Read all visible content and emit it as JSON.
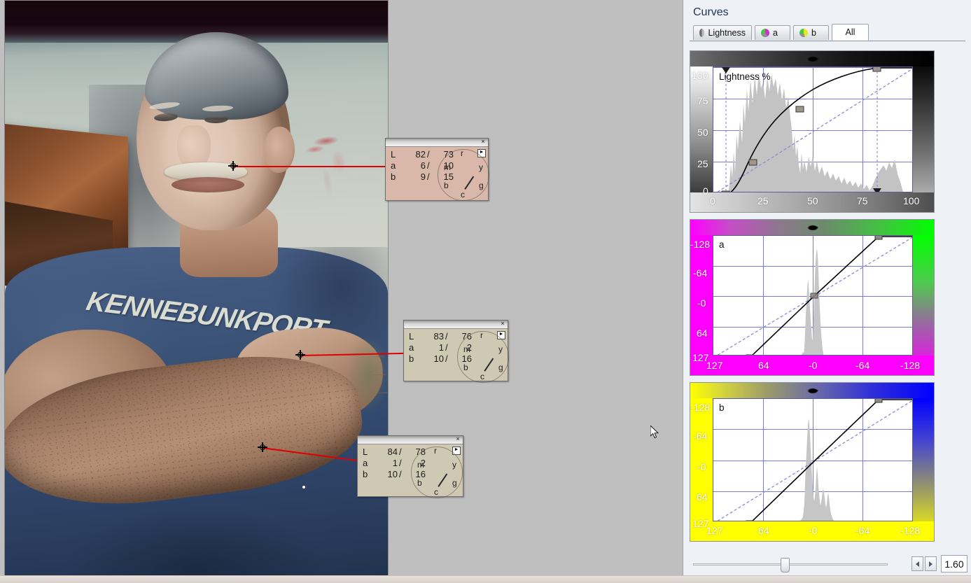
{
  "app": {
    "panel_title": "Curves"
  },
  "tabs": [
    {
      "id": "lightness",
      "label": "Lightness",
      "icon": "lightness-wheel-icon",
      "active": false
    },
    {
      "id": "a",
      "label": "a",
      "icon": "a-channel-wheel-icon",
      "active": false
    },
    {
      "id": "b",
      "label": "b",
      "icon": "b-channel-wheel-icon",
      "active": false
    },
    {
      "id": "all",
      "label": "All",
      "icon": null,
      "active": true
    }
  ],
  "zoom_toolbar": {
    "slider_value_label": "1.60",
    "left_arrow": "◄",
    "right_arrow": "►"
  },
  "samples": [
    {
      "id": "sample-1",
      "title_close": "×",
      "menu_glyph": "►",
      "rows": [
        {
          "label": "L",
          "before": "82",
          "sep": "/",
          "after": "73"
        },
        {
          "label": "a",
          "before": "6",
          "sep": "/",
          "after": "10"
        },
        {
          "label": "b",
          "before": "9",
          "sep": "/",
          "after": "15"
        }
      ],
      "wheel_labels": [
        "r",
        "y",
        "g",
        "c",
        "b",
        "m"
      ]
    },
    {
      "id": "sample-2",
      "title_close": "×",
      "menu_glyph": "►",
      "rows": [
        {
          "label": "L",
          "before": "83",
          "sep": "/",
          "after": "76"
        },
        {
          "label": "a",
          "before": "1",
          "sep": "/",
          "after": "2"
        },
        {
          "label": "b",
          "before": "10",
          "sep": "/",
          "after": "16"
        }
      ],
      "wheel_labels": [
        "r",
        "y",
        "g",
        "c",
        "b",
        "m"
      ]
    },
    {
      "id": "sample-3",
      "title_close": "×",
      "menu_glyph": "►",
      "rows": [
        {
          "label": "L",
          "before": "84",
          "sep": "/",
          "after": "78"
        },
        {
          "label": "a",
          "before": "1",
          "sep": "/",
          "after": "2"
        },
        {
          "label": "b",
          "before": "10",
          "sep": "/",
          "after": "16"
        }
      ],
      "wheel_labels": [
        "r",
        "y",
        "g",
        "c",
        "b",
        "m"
      ]
    }
  ],
  "photo": {
    "shirt_text": "KENNEBUNKPORT"
  },
  "chart_data": [
    {
      "id": "lightness-curve",
      "type": "line",
      "title": "Lightness %",
      "xlabel": "",
      "ylabel": "",
      "xlim": [
        0,
        100
      ],
      "ylim": [
        0,
        100
      ],
      "xticks": [
        0,
        25,
        50,
        75,
        100
      ],
      "yticks": [
        0,
        25,
        50,
        75,
        100
      ],
      "grid": true,
      "gradient": "black-to-white",
      "series": [
        {
          "name": "curve",
          "style": "solid",
          "points": [
            [
              0,
              0
            ],
            [
              6,
              0
            ],
            [
              10,
              4
            ],
            [
              15,
              20
            ],
            [
              20,
              33
            ],
            [
              25,
              44
            ],
            [
              30,
              53
            ],
            [
              35,
              60
            ],
            [
              43,
              67
            ],
            [
              50,
              75
            ],
            [
              60,
              84
            ],
            [
              70,
              92
            ],
            [
              81,
              99
            ],
            [
              82,
              100
            ],
            [
              100,
              100
            ]
          ]
        },
        {
          "name": "identity",
          "style": "dashed",
          "points": [
            [
              0,
              0
            ],
            [
              100,
              100
            ]
          ]
        }
      ],
      "control_points": [
        [
          6,
          0
        ],
        [
          20,
          33
        ],
        [
          43,
          67
        ],
        [
          82,
          100
        ]
      ],
      "markers": {
        "black_point": 6,
        "white_point": 82
      },
      "histogram_note": "luminance histogram, peak mass between 15 and 40"
    },
    {
      "id": "a-curve",
      "type": "line",
      "title": "a",
      "xlabel": "",
      "ylabel": "",
      "xlim": [
        127,
        -128
      ],
      "ylim": [
        127,
        -128
      ],
      "xticks": [
        127,
        64,
        0,
        -64,
        -128
      ],
      "yticks": [
        -128,
        -64,
        0,
        64,
        127
      ],
      "xticklabels": [
        "127",
        "64",
        "-0",
        "-64",
        "-128"
      ],
      "yticklabels": [
        "-128",
        "-64",
        "-0",
        "64",
        "127"
      ],
      "grid": true,
      "gradient": "magenta-to-green",
      "series": [
        {
          "name": "curve",
          "style": "solid",
          "points": [
            [
              127,
              127
            ],
            [
              77,
              127
            ],
            [
              0,
              0
            ],
            [
              -92,
              -128
            ],
            [
              -128,
              -128
            ]
          ]
        },
        {
          "name": "identity",
          "style": "dashed",
          "points": [
            [
              127,
              127
            ],
            [
              -128,
              -128
            ]
          ]
        }
      ],
      "control_points": [
        [
          77,
          127
        ],
        [
          0,
          0
        ],
        [
          -92,
          -128
        ]
      ],
      "histogram_note": "narrow twin spike centred just right of 0"
    },
    {
      "id": "b-curve",
      "type": "line",
      "title": "b",
      "xlabel": "",
      "ylabel": "",
      "xlim": [
        127,
        -128
      ],
      "ylim": [
        127,
        -128
      ],
      "xticks": [
        127,
        64,
        0,
        -64,
        -128
      ],
      "yticks": [
        -128,
        -64,
        0,
        64,
        127
      ],
      "xticklabels": [
        "127",
        "64",
        "-0",
        "-64",
        "-128"
      ],
      "yticklabels": [
        "-128",
        "-64",
        "-0",
        "64",
        "127"
      ],
      "grid": true,
      "gradient": "yellow-to-blue",
      "series": [
        {
          "name": "curve",
          "style": "solid",
          "points": [
            [
              127,
              127
            ],
            [
              77,
              127
            ],
            [
              0,
              0
            ],
            [
              -92,
              -128
            ],
            [
              -128,
              -128
            ]
          ]
        },
        {
          "name": "identity",
          "style": "dashed",
          "points": [
            [
              127,
              127
            ],
            [
              -128,
              -128
            ]
          ]
        }
      ],
      "control_points": [
        [
          77,
          127
        ],
        [
          0,
          0
        ],
        [
          -92,
          -128
        ]
      ],
      "histogram_note": "tall spike just left of 0 with broad secondary lobe toward positive b"
    }
  ]
}
